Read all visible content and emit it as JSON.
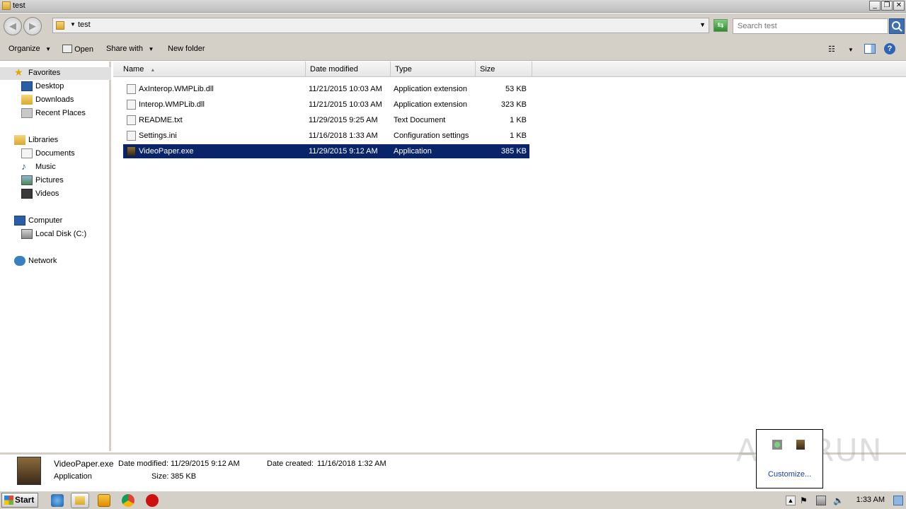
{
  "window": {
    "title": "test"
  },
  "address": {
    "crumb": "test"
  },
  "search": {
    "placeholder": "Search test"
  },
  "toolbar": {
    "organize": "Organize",
    "open": "Open",
    "share_with": "Share with",
    "new_folder": "New folder"
  },
  "nav": {
    "favorites": "Favorites",
    "desktop": "Desktop",
    "downloads": "Downloads",
    "recent_places": "Recent Places",
    "libraries": "Libraries",
    "documents": "Documents",
    "music": "Music",
    "pictures": "Pictures",
    "videos": "Videos",
    "computer": "Computer",
    "local_disk": "Local Disk (C:)",
    "network": "Network"
  },
  "columns": {
    "name": "Name",
    "date": "Date modified",
    "type": "Type",
    "size": "Size"
  },
  "files": [
    {
      "name": "AxInterop.WMPLib.dll",
      "date": "11/21/2015 10:03 AM",
      "type": "Application extension",
      "size": "53 KB"
    },
    {
      "name": "Interop.WMPLib.dll",
      "date": "11/21/2015 10:03 AM",
      "type": "Application extension",
      "size": "323 KB"
    },
    {
      "name": "README.txt",
      "date": "11/29/2015 9:25 AM",
      "type": "Text Document",
      "size": "1 KB"
    },
    {
      "name": "Settings.ini",
      "date": "11/16/2018 1:33 AM",
      "type": "Configuration settings",
      "size": "1 KB"
    },
    {
      "name": "VideoPaper.exe",
      "date": "11/29/2015 9:12 AM",
      "type": "Application",
      "size": "385 KB"
    }
  ],
  "details": {
    "filename": "VideoPaper.exe",
    "type": "Application",
    "date_modified_label": "Date modified:",
    "date_modified": "11/29/2015 9:12 AM",
    "date_created_label": "Date created:",
    "date_created": "11/16/2018 1:32 AM",
    "size_label": "Size:",
    "size": "385 KB"
  },
  "tray_popup": {
    "customize": "Customize..."
  },
  "watermark": "ANY RUN",
  "taskbar": {
    "start": "Start",
    "clock": "1:33 AM"
  }
}
